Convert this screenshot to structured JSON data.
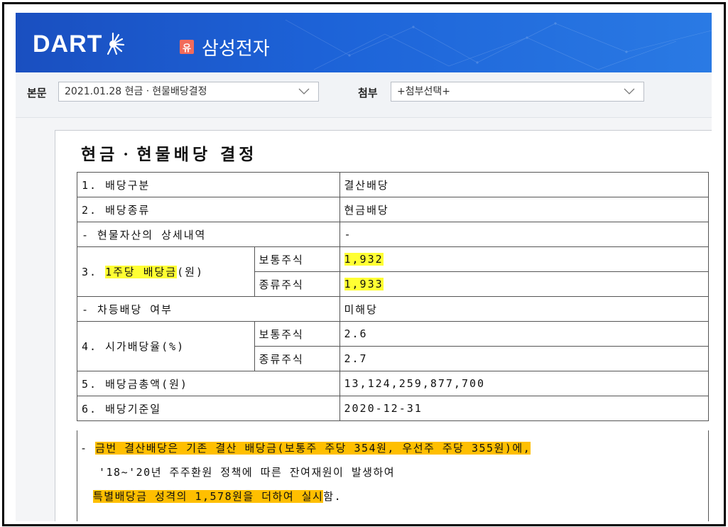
{
  "header": {
    "logo_text": "DART",
    "badge": "유",
    "company_name": "삼성전자"
  },
  "selectors": {
    "main_label": "본문",
    "main_value": "2021.01.28  현금ㆍ현물배당결정",
    "attach_label": "첨부",
    "attach_value": "+첨부선택+"
  },
  "document": {
    "title": "현금ㆍ현물배당 결정",
    "rows": {
      "r1_label": "1. 배당구분",
      "r1_value": "결산배당",
      "r2_label": "2. 배당종류",
      "r2_value": "현금배당",
      "r2a_label": "- 현물자산의 상세내역",
      "r2a_value": "-",
      "r3_prefix": "3. ",
      "r3_highlight": "1주당 배당금",
      "r3_suffix": "(원)",
      "r3_common_label": "보통주식",
      "r3_common_value": "1,932",
      "r3_pref_label": "종류주식",
      "r3_pref_value": "1,933",
      "r3a_label": "- 차등배당 여부",
      "r3a_value": "미해당",
      "r4_label": "4. 시가배당율(%)",
      "r4_common_label": "보통주식",
      "r4_common_value": "2.6",
      "r4_pref_label": "종류주식",
      "r4_pref_value": "2.7",
      "r5_label": "5. 배당금총액(원)",
      "r5_value": "13,124,259,877,700",
      "r6_label": "6. 배당기준일",
      "r6_value": "2020-12-31"
    },
    "remarks": {
      "dash": "- ",
      "line1": "금번 결산배당은 기존 결산 배당금(보통주 주당 354원, 우선주 주당 355원)에,",
      "line2": "'18~'20년 주주환원 정책에 따른 잔여재원이 발생하여",
      "line3_highlight": "특별배당금 성격의 1,578원을 더하여 실시",
      "line3_tail": "함."
    }
  },
  "colors": {
    "header_blue": "#1d63d8",
    "badge_red": "#f26b5b",
    "highlight_yellow": "#ffff33",
    "highlight_orange": "#ffbf00"
  }
}
